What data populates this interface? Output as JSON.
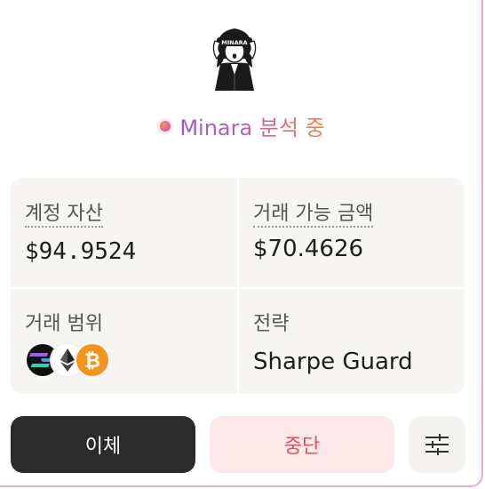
{
  "avatar": {
    "caption": "MINARA",
    "icon": "minara-avatar-icon"
  },
  "status": {
    "text": "Minara 분석 중",
    "icon": "status-dot-icon"
  },
  "stats": {
    "account_assets_label": "계정 자산",
    "account_assets_value": "$94.9524",
    "tradable_amount_label": "거래 가능 금액",
    "tradable_amount_value": "$70.4626",
    "trading_range_label": "거래 범위",
    "strategy_label": "전략",
    "strategy_value": "Sharpe Guard"
  },
  "coins": [
    {
      "name": "solana-icon",
      "color": "#111111"
    },
    {
      "name": "ethereum-icon",
      "color": "#ffffff"
    },
    {
      "name": "bitcoin-icon",
      "color": "#f7931a"
    }
  ],
  "actions": {
    "transfer_label": "이체",
    "stop_label": "중단",
    "settings_icon": "sliders-icon"
  },
  "colors": {
    "accent_gradient_start": "#9a58dd",
    "accent_gradient_end": "#f0863f",
    "stop_text": "#e4505a",
    "stop_bg": "#fde8ea",
    "dark_button": "#2b2b2b",
    "frame_border": "#f0a8cf"
  }
}
